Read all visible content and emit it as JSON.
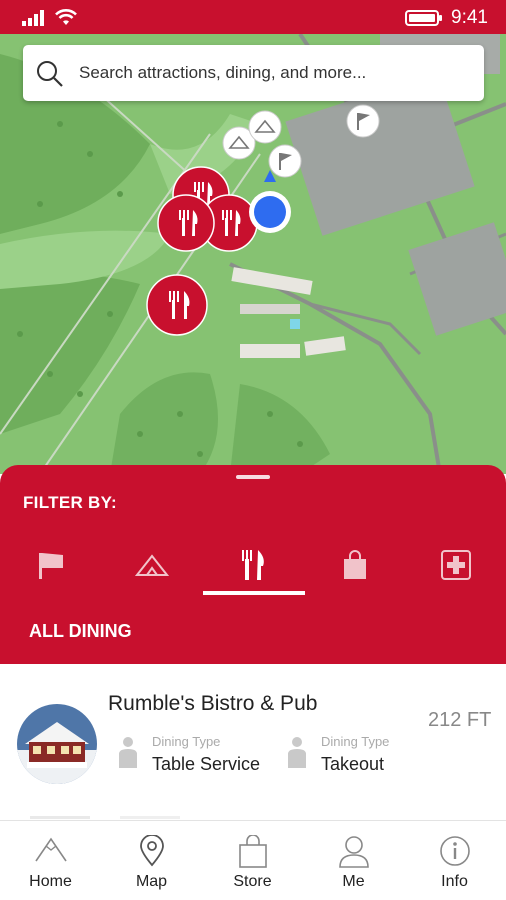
{
  "status_bar": {
    "time": "9:41"
  },
  "search": {
    "placeholder": "Search attractions, dining, and more..."
  },
  "filter": {
    "title": "FILTER BY:",
    "categories": [
      {
        "icon": "flag-icon",
        "name": "flag"
      },
      {
        "icon": "lodging-icon",
        "name": "lodging"
      },
      {
        "icon": "dining-icon",
        "name": "dining",
        "selected": true
      },
      {
        "icon": "shopping-bag-icon",
        "name": "shopping"
      },
      {
        "icon": "first-aid-icon",
        "name": "medical"
      }
    ],
    "selected_label": "ALL DINING"
  },
  "list": {
    "items": [
      {
        "name": "Rumble's Bistro & Pub",
        "distance": "212 FT",
        "attributes": [
          {
            "label": "Dining Type",
            "value": "Table Service"
          },
          {
            "label": "Dining Type",
            "value": "Takeout"
          }
        ]
      }
    ]
  },
  "bottom_nav": {
    "items": [
      {
        "label": "Home",
        "icon": "mountain-icon"
      },
      {
        "label": "Map",
        "icon": "map-pin-icon"
      },
      {
        "label": "Store",
        "icon": "shopping-bag-icon"
      },
      {
        "label": "Me",
        "icon": "person-icon"
      },
      {
        "label": "Info",
        "icon": "info-icon"
      }
    ]
  },
  "colors": {
    "brand_red": "#c8102e",
    "map_green": "#86c272",
    "location_blue": "#2e6cf0"
  }
}
